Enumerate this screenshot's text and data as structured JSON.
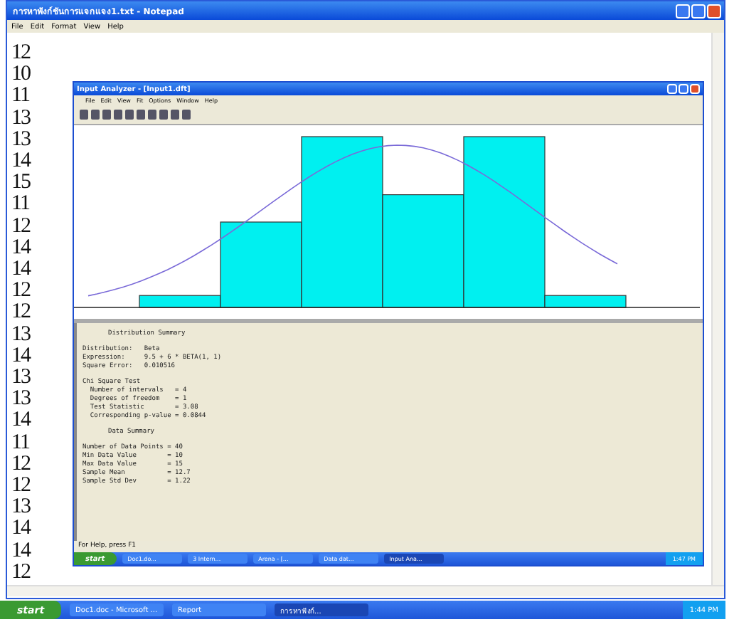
{
  "notepad": {
    "title": "การหาฟังก์ชันการแจกแจง1.txt - Notepad",
    "menu": [
      "File",
      "Edit",
      "Format",
      "View",
      "Help"
    ],
    "lines": [
      "12",
      "10",
      "11",
      "13",
      "13",
      "14",
      "15",
      "11",
      "12",
      "14",
      "14",
      "12",
      "12",
      "13",
      "14",
      "13",
      "13",
      "14",
      "11",
      "12",
      "12",
      "13",
      "14",
      "14",
      "12"
    ]
  },
  "analyzer": {
    "title": "Input Analyzer - [Input1.dft]",
    "menu": [
      "File",
      "Edit",
      "View",
      "Fit",
      "Options",
      "Window",
      "Help"
    ],
    "summary": [
      {
        "kind": "heading",
        "lines": [
          "Distribution Summary"
        ]
      },
      {
        "kind": "body",
        "lines": [
          "Distribution:   Beta",
          "Expression:     9.5 + 6 * BETA(1, 1)",
          "Square Error:   0.010516"
        ]
      },
      {
        "kind": "body",
        "lines": [
          "Chi Square Test",
          "  Number of intervals   = 4",
          "  Degrees of freedom    = 1",
          "  Test Statistic        = 3.08",
          "  Corresponding p-value = 0.0844"
        ]
      },
      {
        "kind": "heading",
        "lines": [
          "Data Summary"
        ]
      },
      {
        "kind": "body",
        "lines": [
          "Number of Data Points = 40",
          "Min Data Value        = 10",
          "Max Data Value        = 15",
          "Sample Mean           = 12.7",
          "Sample Std Dev        = 1.22"
        ]
      }
    ],
    "status_bar": "For Help, press F1",
    "taskbar": {
      "start": "start",
      "tasks": [
        {
          "label": "Doc1.do...",
          "selected": false
        },
        {
          "label": "3 Intern...",
          "selected": false
        },
        {
          "label": "Arena - [...",
          "selected": false
        },
        {
          "label": "Data dat...",
          "selected": false
        },
        {
          "label": "Input Ana...",
          "selected": true
        }
      ],
      "clock": "1:47 PM"
    }
  },
  "taskbar": {
    "start": "start",
    "tasks": [
      {
        "label": "Doc1.doc - Microsoft ...",
        "selected": false
      },
      {
        "label": "Report",
        "selected": false
      },
      {
        "label": "การหาฟังก์...",
        "selected": true
      }
    ],
    "clock": "1:44 PM"
  }
}
